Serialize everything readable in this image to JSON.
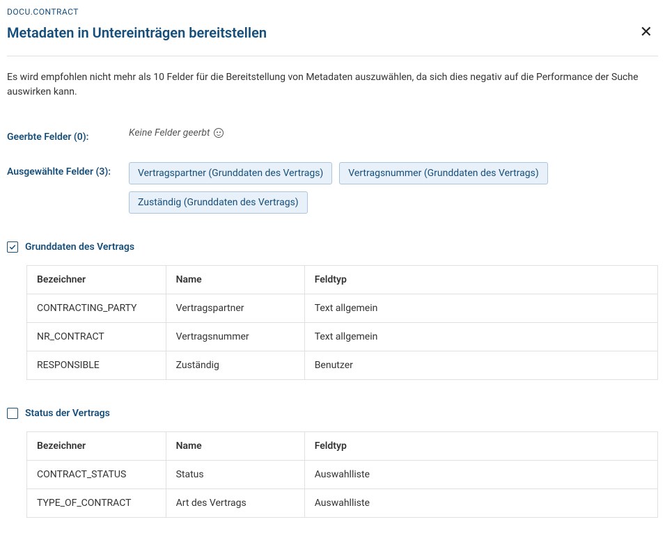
{
  "breadcrumb": "DOCU.CONTRACT",
  "title": "Metadaten in Untereinträgen bereitstellen",
  "info": "Es wird empfohlen nicht mehr als 10 Felder für die Bereitstellung von Metadaten auszuwählen, da sich dies negativ auf die Performance der Suche auswirken kann.",
  "inherited": {
    "label": "Geerbte Felder (0):",
    "empty_text": "Keine Felder geerbt"
  },
  "selected": {
    "label": "Ausgewählte Felder (3):",
    "chips": [
      "Vertragspartner (Grunddaten des Vertrags)",
      "Vertragsnummer (Grunddaten des Vertrags)",
      "Zuständig (Grunddaten des Vertrags)"
    ]
  },
  "table_headers": {
    "id": "Bezeichner",
    "name": "Name",
    "type": "Feldtyp"
  },
  "sections": [
    {
      "title": "Grunddaten des Vertrags",
      "checked": true,
      "rows": [
        {
          "id": "CONTRACTING_PARTY",
          "name": "Vertragspartner",
          "type": "Text allgemein"
        },
        {
          "id": "NR_CONTRACT",
          "name": "Vertragsnummer",
          "type": "Text allgemein"
        },
        {
          "id": "RESPONSIBLE",
          "name": "Zuständig",
          "type": "Benutzer"
        }
      ]
    },
    {
      "title": "Status der Vertrags",
      "checked": false,
      "rows": [
        {
          "id": "CONTRACT_STATUS",
          "name": "Status",
          "type": "Auswahlliste"
        },
        {
          "id": "TYPE_OF_CONTRACT",
          "name": "Art des Vertrags",
          "type": "Auswahlliste"
        }
      ]
    }
  ]
}
